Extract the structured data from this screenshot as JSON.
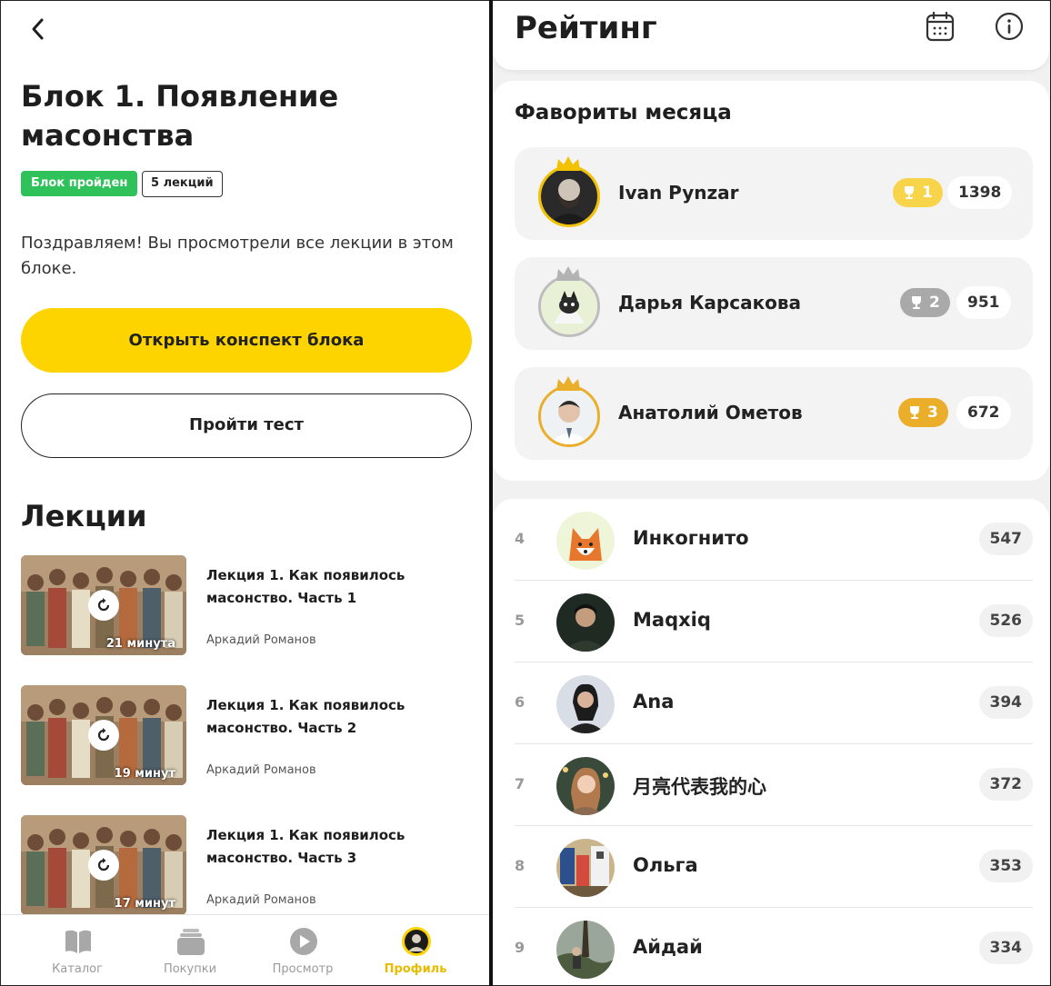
{
  "left": {
    "block_title": "Блок 1. Появление масонства",
    "badge_done": "Блок пройден",
    "badge_count": "5 лекций",
    "congrats": "Поздравляем! Вы просмотрели все лекции в этом блоке.",
    "open_summary_button": "Открыть конспект блока",
    "take_test_button": "Пройти тест",
    "lectures_heading": "Лекции",
    "lectures": [
      {
        "title": "Лекция 1. Как появилось масонство. Часть 1",
        "author": "Аркадий Романов",
        "duration": "21 минута"
      },
      {
        "title": "Лекция 1. Как появилось масонство. Часть 2",
        "author": "Аркадий Романов",
        "duration": "19 минут"
      },
      {
        "title": "Лекция 1. Как появилось масонство. Часть 3",
        "author": "Аркадий Романов",
        "duration": "17 минут"
      }
    ],
    "tabs": [
      {
        "label": "Каталог",
        "icon": "book-icon"
      },
      {
        "label": "Покупки",
        "icon": "stack-icon"
      },
      {
        "label": "Просмотр",
        "icon": "play-icon"
      },
      {
        "label": "Профиль",
        "icon": "profile-avatar-icon",
        "active": true
      }
    ]
  },
  "right": {
    "title": "Рейтинг",
    "favorites_heading": "Фавориты месяца",
    "favorites": [
      {
        "name": "Ivan Pynzar",
        "place": "1",
        "score": "1398",
        "cup_color": "#f7d44a"
      },
      {
        "name": "Дарья Карсакова",
        "place": "2",
        "score": "951",
        "cup_color": "#a9a9a9"
      },
      {
        "name": "Анатолий Ометов",
        "place": "3",
        "score": "672",
        "cup_color": "#eaae2a"
      }
    ],
    "rows": [
      {
        "rank": "4",
        "name": "Инкогнито",
        "score": "547"
      },
      {
        "rank": "5",
        "name": "Maqxiq",
        "score": "526"
      },
      {
        "rank": "6",
        "name": "Ana",
        "score": "394"
      },
      {
        "rank": "7",
        "name": "月亮代表我的心",
        "score": "372"
      },
      {
        "rank": "8",
        "name": "Ольга",
        "score": "353"
      },
      {
        "rank": "9",
        "name": "Айдай",
        "score": "334"
      }
    ]
  },
  "colors": {
    "accent": "#fdd400",
    "success": "#2fc25b",
    "tab_active": "#e6bb00"
  }
}
